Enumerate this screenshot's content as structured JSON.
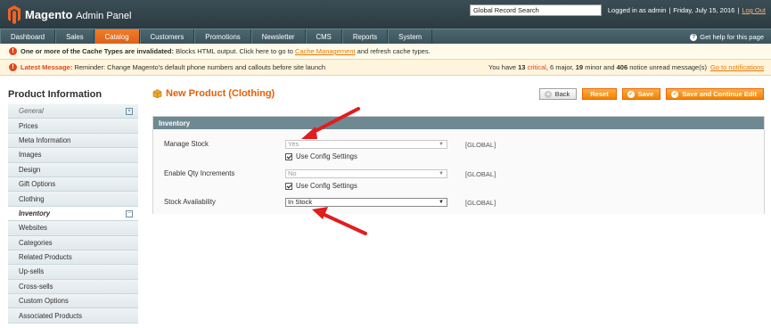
{
  "header": {
    "logo_main": "Magento",
    "logo_sub": "Admin Panel",
    "search_value": "Global Record Search",
    "logged_in": "Logged in as admin",
    "date": "Friday, July 15, 2016",
    "logout": "Log Out"
  },
  "nav": {
    "items": [
      "Dashboard",
      "Sales",
      "Catalog",
      "Customers",
      "Promotions",
      "Newsletter",
      "CMS",
      "Reports",
      "System"
    ],
    "active": "Catalog",
    "help": "Get help for this page"
  },
  "messages": {
    "cache_prefix": "One or more of the Cache Types are invalidated:",
    "cache_text": " Blocks HTML output. Click here to go to ",
    "cache_link": "Cache Management",
    "cache_suffix": " and refresh cache types.",
    "latest_label": "Latest Message:",
    "latest_text": " Reminder: Change Magento's default phone numbers and callouts before site launch",
    "notice_prefix": "You have ",
    "critical_count": "13",
    "critical_label": "critical",
    "major": ", 6 major, ",
    "minor_count": "19",
    "minor_text": " minor and ",
    "notice_count": "406",
    "notice_text": " notice unread message(s)",
    "notifications_link": "Go to notifications"
  },
  "sidebar": {
    "title": "Product Information",
    "items": [
      {
        "label": "General"
      },
      {
        "label": "Prices"
      },
      {
        "label": "Meta Information"
      },
      {
        "label": "Images"
      },
      {
        "label": "Design"
      },
      {
        "label": "Gift Options"
      },
      {
        "label": "Clothing"
      },
      {
        "label": "Inventory"
      },
      {
        "label": "Websites"
      },
      {
        "label": "Categories"
      },
      {
        "label": "Related Products"
      },
      {
        "label": "Up-sells"
      },
      {
        "label": "Cross-sells"
      },
      {
        "label": "Custom Options"
      },
      {
        "label": "Associated Products"
      }
    ]
  },
  "page": {
    "title": "New Product (Clothing)",
    "buttons": {
      "back": "Back",
      "reset": "Reset",
      "save": "Save",
      "save_continue": "Save and Continue Edit"
    }
  },
  "inventory": {
    "header": "Inventory",
    "manage_stock_label": "Manage Stock",
    "manage_stock_value": "Yes",
    "enable_qty_label": "Enable Qty Increments",
    "enable_qty_value": "No",
    "use_config": "Use Config Settings",
    "stock_availability_label": "Stock Availability",
    "stock_availability_value": "In Stock",
    "scope": "[GLOBAL]"
  },
  "colors": {
    "accent": "#eb5e00",
    "nav_bg": "#3b535b",
    "arrow": "#e11d1d"
  }
}
